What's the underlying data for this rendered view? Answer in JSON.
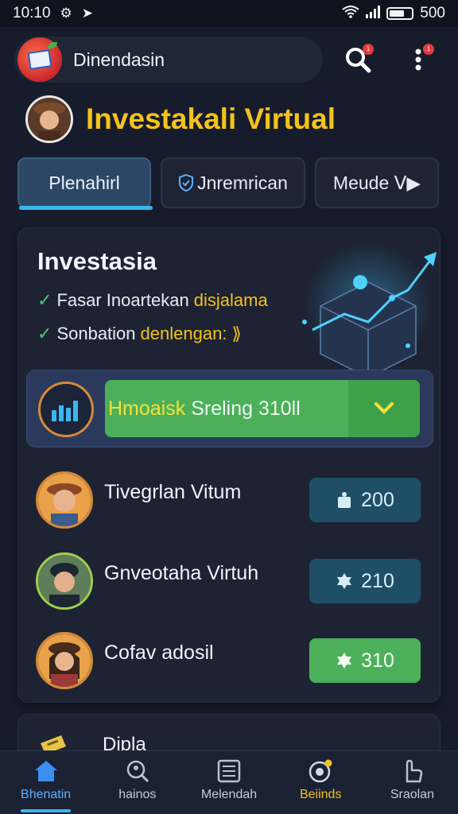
{
  "status_bar": {
    "time": "10:10",
    "battery": "500"
  },
  "header": {
    "app_name": "Dinendasin",
    "search_badge": "1",
    "menu_badge": "1"
  },
  "page": {
    "title": "Investakali Virtual"
  },
  "tabs": [
    {
      "label": "Plenahirl",
      "active": true
    },
    {
      "label": "Jnremrican",
      "icon": "shield-icon"
    },
    {
      "label": "Meude ᐯ▶"
    }
  ],
  "card": {
    "title": "Investasia",
    "features": [
      {
        "text": "Fasar Inoartekan",
        "highlight": "disjalama"
      },
      {
        "text": "Sonbation",
        "highlight": "denlengan: ⟫"
      }
    ],
    "promo": {
      "label_a": "Hmoaisk",
      "label_b": " Sreling 310ll"
    },
    "list": [
      {
        "name": "Tivegrlan Vitum",
        "value": "200",
        "badge_color": "#1f4f66"
      },
      {
        "name": "Gnveotaha Virtuh",
        "value": "210",
        "badge_color": "#1f4f66"
      },
      {
        "name": "Cofav adosil",
        "value": "310",
        "badge_color": "#4cb05a"
      }
    ]
  },
  "peek_card": {
    "title": "Dipla"
  },
  "nav": [
    {
      "label": "Bhenatin",
      "icon": "home-icon",
      "active": true
    },
    {
      "label": "hainos",
      "icon": "search-user-icon"
    },
    {
      "label": "Melendah",
      "icon": "list-doc-icon"
    },
    {
      "label": "Beiinds",
      "icon": "target-icon",
      "gold": true
    },
    {
      "label": "Sraolan",
      "icon": "hand-icon"
    }
  ],
  "colors": {
    "accent": "#3bb6ee",
    "gold": "#f4c21b",
    "green": "#4cb05a"
  }
}
